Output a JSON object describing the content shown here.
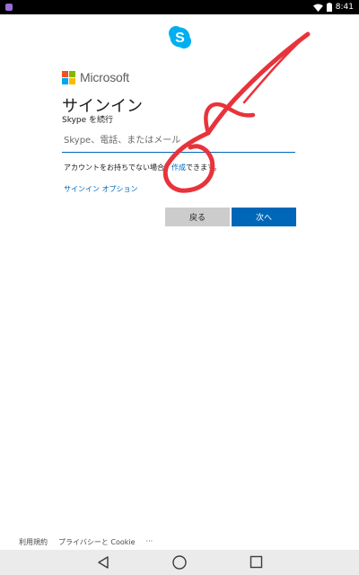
{
  "status_bar": {
    "time": "8:41",
    "icons": [
      "app-icon",
      "wifi-icon",
      "battery-icon"
    ]
  },
  "brand": {
    "skype_icon": "skype-logo-icon",
    "microsoft_name": "Microsoft"
  },
  "signin": {
    "title": "サインイン",
    "subtitle": "Skype を続行",
    "input_placeholder": "Skype、電話、またはメール",
    "no_account_prefix": "アカウントをお持ちでない場合、",
    "create_link": "作成",
    "no_account_suffix": "できます。",
    "options_link": "サインイン オプション",
    "back_button": "戻る",
    "next_button": "次へ"
  },
  "footer": {
    "terms": "利用規約",
    "privacy": "プライバシーと Cookie",
    "more": "···"
  },
  "nav": {
    "icons": [
      "back-icon",
      "home-icon",
      "recents-icon"
    ]
  },
  "colors": {
    "accent": "#0067b8",
    "skype_blue": "#00aff0",
    "annotation_red": "#e8333b"
  }
}
